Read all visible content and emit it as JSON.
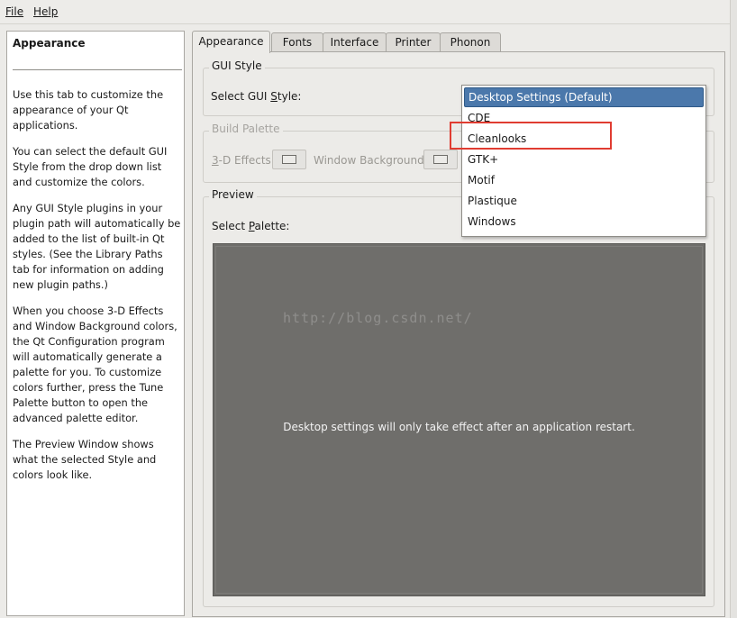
{
  "menubar": {
    "file": "File",
    "help": "Help"
  },
  "help_pane": {
    "title": "Appearance",
    "paragraphs": [
      "Use this tab to customize the appearance of your Qt applications.",
      "You can select the default GUI Style from the drop down list and customize the colors.",
      "Any GUI Style plugins in your plugin path will automatically be added to the list of built-in Qt styles. (See the Library Paths tab for information on adding new plugin paths.)",
      "When you choose 3-D Effects and Window Background colors, the Qt Configuration program will automatically generate a palette for you. To customize colors further, press the Tune Palette button to open the advanced palette editor.",
      "The Preview Window shows what the selected Style and colors look like."
    ]
  },
  "tabs": [
    "Appearance",
    "Fonts",
    "Interface",
    "Printer",
    "Phonon"
  ],
  "active_tab": "Appearance",
  "gui_style": {
    "group_title": "GUI Style",
    "select_label": "Select GUI Style:",
    "current": "Desktop Settings (Default)",
    "options": [
      "Desktop Settings (Default)",
      "CDE",
      "Cleanlooks",
      "GTK+",
      "Motif",
      "Plastique",
      "Windows"
    ]
  },
  "build_palette": {
    "group_title": "Build Palette",
    "effects_label": "3-D Effects:",
    "window_bg_label": "Window Background:"
  },
  "preview": {
    "group_title": "Preview",
    "select_palette_label": "Select Palette:",
    "message": "Desktop settings will only take effect after an application restart.",
    "watermark": "http://blog.csdn.net/"
  },
  "colors": {
    "selection": "#4b78ab",
    "highlight_box": "#e03c31",
    "preview_bg": "#6f6e6b"
  }
}
